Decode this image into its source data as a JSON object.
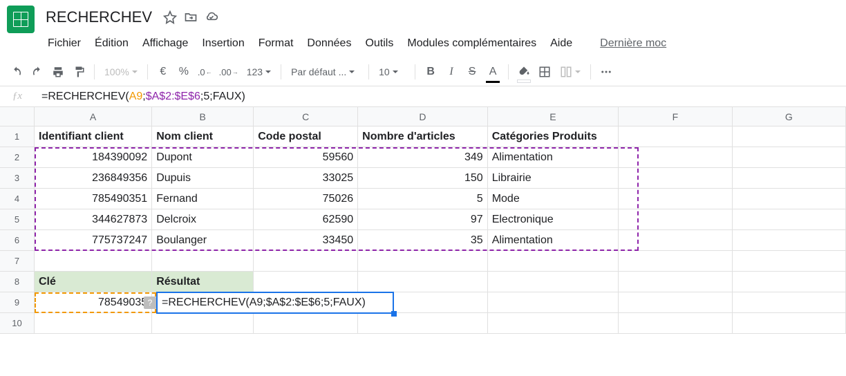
{
  "doc_title": "RECHERCHEV",
  "menus": [
    "Fichier",
    "Édition",
    "Affichage",
    "Insertion",
    "Format",
    "Données",
    "Outils",
    "Modules complémentaires",
    "Aide"
  ],
  "menu_secondary": "Dernière moc",
  "toolbar": {
    "zoom": "100%",
    "currency": "€",
    "percent": "%",
    "dec_dec": ".0",
    "dec_inc": ".00",
    "more_fmt": "123",
    "font": "Par défaut ...",
    "font_size": "10",
    "bold": "B",
    "italic": "I",
    "strike": "S",
    "text_color": "A"
  },
  "formula": {
    "prefix": "=RECHERCHEV(",
    "arg1": "A9",
    "sep1": ";",
    "arg2": "$A$2:$E$6",
    "sep2": ";",
    "arg3": "5",
    "sep3": ";",
    "arg4": "FAUX",
    "suffix": ")"
  },
  "columns": [
    "A",
    "B",
    "C",
    "D",
    "E",
    "F",
    "G"
  ],
  "row_numbers": [
    "1",
    "2",
    "3",
    "4",
    "5",
    "6",
    "7",
    "8",
    "9",
    "10"
  ],
  "headers": {
    "A": "Identifiant client",
    "B": "Nom client",
    "C": "Code postal",
    "D": "Nombre d'articles",
    "E": "Catégories Produits"
  },
  "rows": [
    {
      "A": "184390092",
      "B": "Dupont",
      "C": "59560",
      "D": "349",
      "E": "Alimentation"
    },
    {
      "A": "236849356",
      "B": "Dupuis",
      "C": "33025",
      "D": "150",
      "E": "Librairie"
    },
    {
      "A": "785490351",
      "B": "Fernand",
      "C": "75026",
      "D": "5",
      "E": "Mode"
    },
    {
      "A": "344627873",
      "B": "Delcroix",
      "C": "62590",
      "D": "97",
      "E": "Electronique"
    },
    {
      "A": "775737247",
      "B": "Boulanger",
      "C": "33450",
      "D": "35",
      "E": "Alimentation"
    }
  ],
  "key_row": {
    "A": "Clé",
    "B": "Résultat"
  },
  "lookup": {
    "A": "78549035"
  },
  "help_badge": "?"
}
